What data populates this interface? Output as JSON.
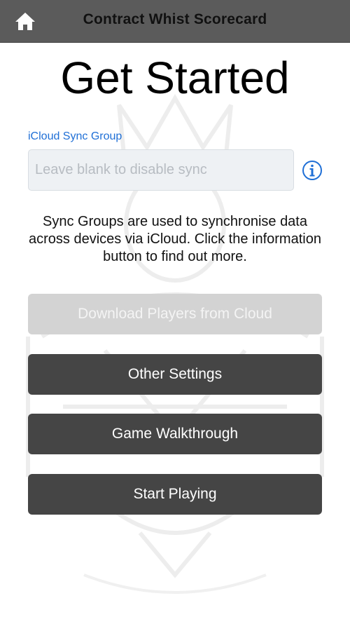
{
  "navbar": {
    "title": "Contract Whist Scorecard",
    "home_icon": "home-icon",
    "background": "#5b5b5b"
  },
  "main": {
    "title": "Get Started",
    "sync_group": {
      "label": "iCloud Sync Group",
      "value": "",
      "placeholder": "Leave blank to disable sync",
      "info_icon": "info-circle-icon"
    },
    "help_text": "Sync Groups are used to synchronise data across devices via iCloud. Click the information button to find out more."
  },
  "buttons": {
    "download_players": {
      "label": "Download Players from Cloud",
      "enabled": false
    },
    "other_settings": {
      "label": "Other Settings",
      "enabled": true
    },
    "game_walkthrough": {
      "label": "Game Walkthrough",
      "enabled": true
    },
    "start_playing": {
      "label": "Start Playing",
      "enabled": true
    }
  },
  "colors": {
    "accent": "#1f6fd6",
    "button_dark": "#454545",
    "button_disabled": "#d3d3d3"
  }
}
